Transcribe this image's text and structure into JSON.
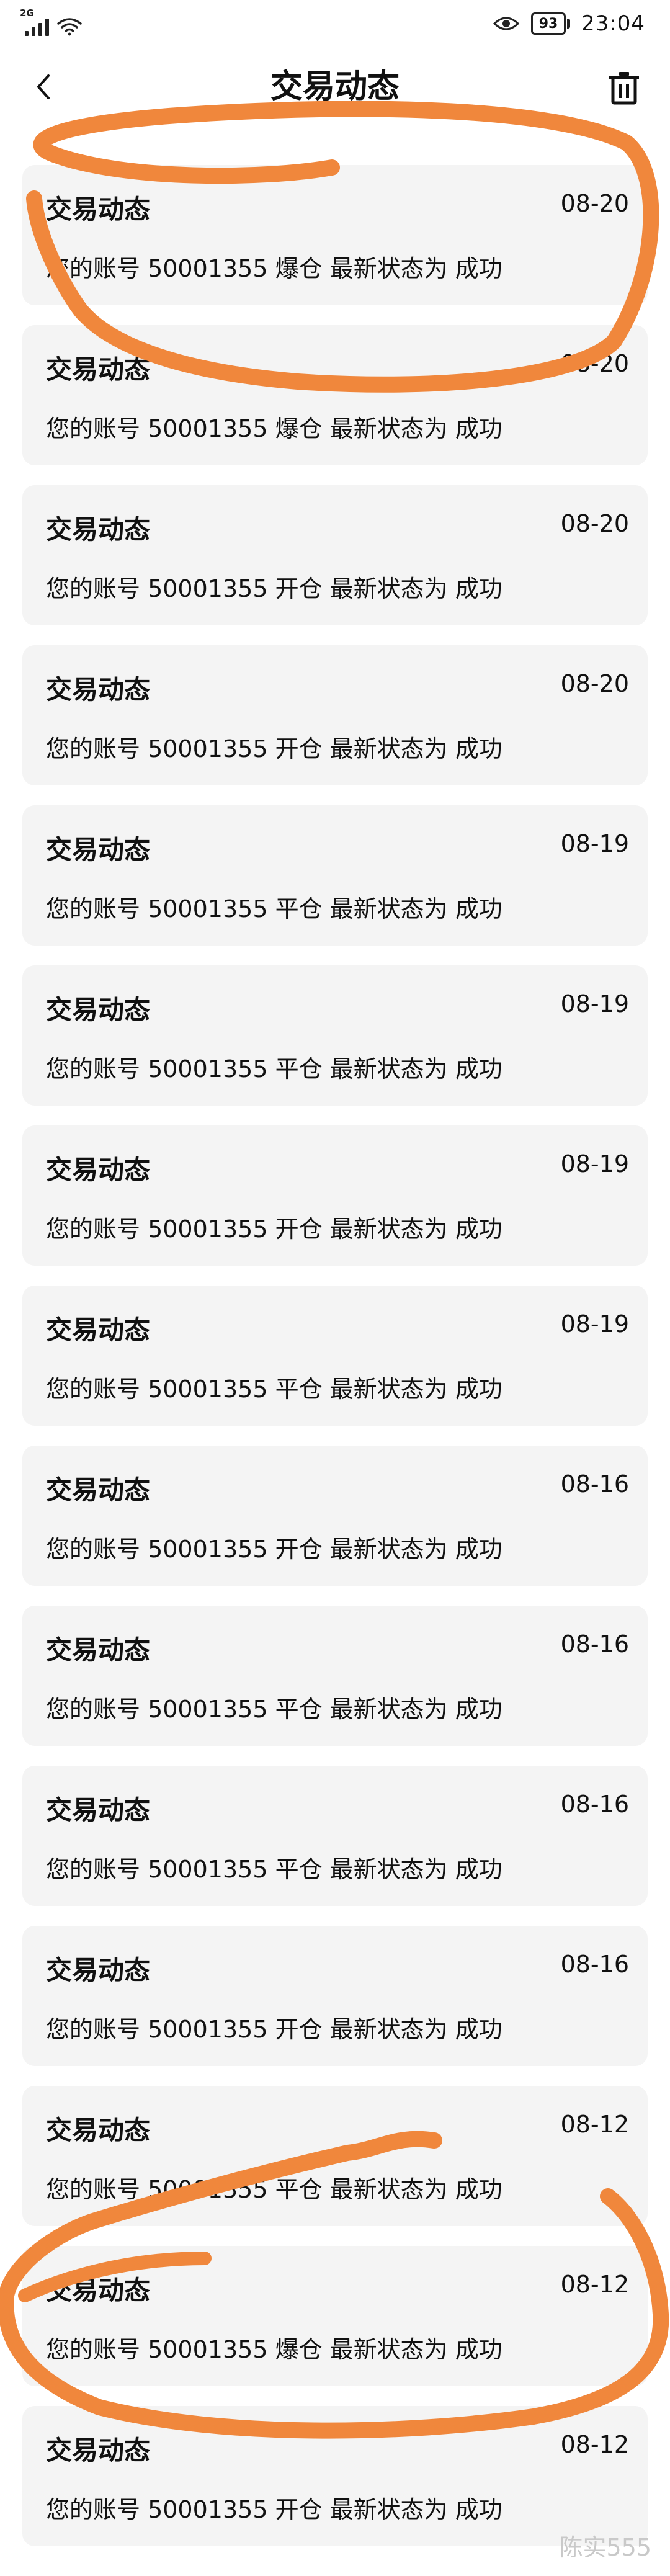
{
  "status_bar": {
    "network": "2G",
    "battery": "93",
    "time": "23:04"
  },
  "header": {
    "title": "交易动态"
  },
  "icons": {
    "back": "chevron-left-icon",
    "trash": "trash-icon",
    "signal": "signal-icon",
    "wifi": "wifi-icon",
    "eye": "eye-icon",
    "battery": "battery-icon"
  },
  "colors": {
    "background": "#ffffff",
    "card": "#f4f4f4",
    "annotation": "#f0873c"
  },
  "notifications": [
    {
      "title": "交易动态",
      "date": "08-20",
      "message": "您的账号 50001355 爆仓 最新状态为 成功"
    },
    {
      "title": "交易动态",
      "date": "08-20",
      "message": "您的账号 50001355 爆仓 最新状态为 成功"
    },
    {
      "title": "交易动态",
      "date": "08-20",
      "message": "您的账号 50001355 开仓 最新状态为 成功"
    },
    {
      "title": "交易动态",
      "date": "08-20",
      "message": "您的账号 50001355 开仓 最新状态为 成功"
    },
    {
      "title": "交易动态",
      "date": "08-19",
      "message": "您的账号 50001355 平仓 最新状态为 成功"
    },
    {
      "title": "交易动态",
      "date": "08-19",
      "message": "您的账号 50001355 平仓 最新状态为 成功"
    },
    {
      "title": "交易动态",
      "date": "08-19",
      "message": "您的账号 50001355 开仓 最新状态为 成功"
    },
    {
      "title": "交易动态",
      "date": "08-19",
      "message": "您的账号 50001355 平仓 最新状态为 成功"
    },
    {
      "title": "交易动态",
      "date": "08-16",
      "message": "您的账号 50001355 开仓 最新状态为 成功"
    },
    {
      "title": "交易动态",
      "date": "08-16",
      "message": "您的账号 50001355 平仓 最新状态为 成功"
    },
    {
      "title": "交易动态",
      "date": "08-16",
      "message": "您的账号 50001355 平仓 最新状态为 成功"
    },
    {
      "title": "交易动态",
      "date": "08-16",
      "message": "您的账号 50001355 开仓 最新状态为 成功"
    },
    {
      "title": "交易动态",
      "date": "08-12",
      "message": "您的账号 50001355 平仓 最新状态为 成功"
    },
    {
      "title": "交易动态",
      "date": "08-12",
      "message": "您的账号 50001355 爆仓 最新状态为 成功"
    },
    {
      "title": "交易动态",
      "date": "08-12",
      "message": "您的账号 50001355 开仓 最新状态为 成功"
    }
  ],
  "watermark": "陈实555"
}
